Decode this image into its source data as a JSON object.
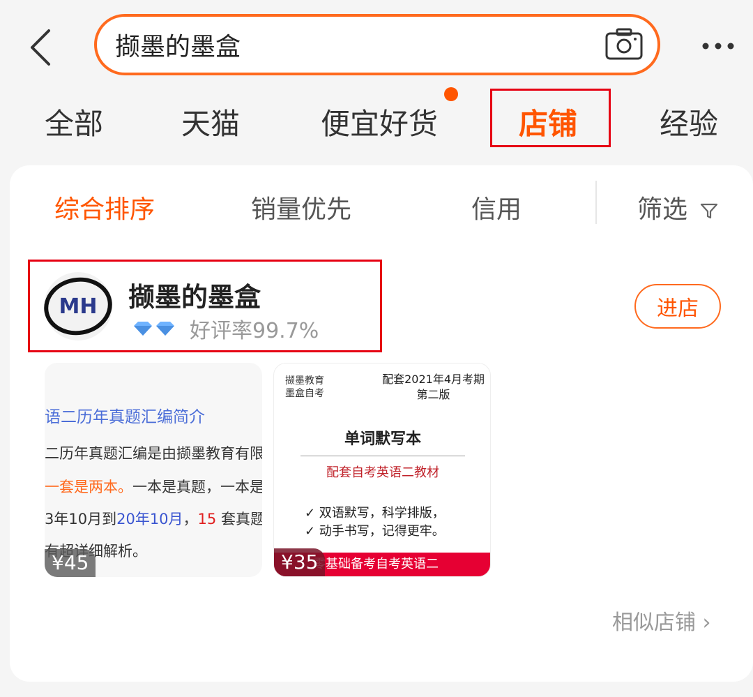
{
  "search": {
    "query": "撷墨的墨盒"
  },
  "tabs": [
    "全部",
    "天猫",
    "便宜好货",
    "店铺",
    "经验"
  ],
  "sort": {
    "items": [
      "综合排序",
      "销量优先",
      "信用",
      "筛选"
    ]
  },
  "shop": {
    "logo_text": "MH",
    "name": "撷墨的墨盒",
    "rating": "好评率99.7%",
    "enter_label": "进店"
  },
  "products": [
    {
      "price": "¥45",
      "lines": {
        "title": "语二历年真题汇编简介",
        "l1": "二历年真题汇编是由撷墨教育有限",
        "l2a": "一套是两本。",
        "l2b": "一本是真题，一本是",
        "l3a": "3年10月到",
        "l3b": "20年10月",
        "l3c": "，",
        "l3d": "15",
        "l3e": " 套真题",
        "l4": "有超详细解析。"
      }
    },
    {
      "price": "¥35",
      "top_left": "撷墨教育\n墨盒自考",
      "top_right_1": "配套2021年4月考期",
      "top_right_2": "第二版",
      "title": "单词默写本",
      "subtitle": "配套自考英语二教材",
      "bullet1": "✓ 双语默写，科学排版，",
      "bullet2": "✓ 动手书写，记得更牢。",
      "banner": "零基础备考自考英语二"
    }
  ],
  "similar_label": "相似店铺 ›",
  "colors": {
    "accent": "#ff5500",
    "highlight": "#e60012"
  }
}
